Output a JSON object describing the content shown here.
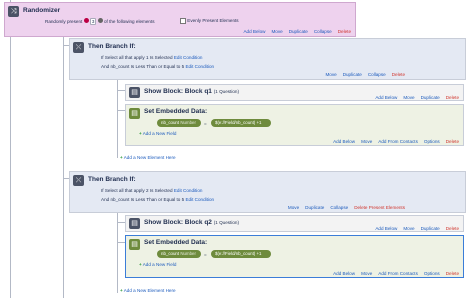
{
  "randomizer": {
    "title": "Randomizer",
    "present_pre": "Randomly present",
    "count": "3",
    "present_post": "of the following elements",
    "evenly_label": "Evenly Present Elements",
    "actions": [
      "Add Below",
      "Move",
      "Duplicate",
      "Collapse",
      "Delete"
    ]
  },
  "branch1": {
    "title": "Then Branch If:",
    "cond1_pre": "If",
    "cond1_text": "Select all that apply",
    "cond1_num": "1",
    "cond1_post": "Is Selected",
    "cond1_edit": "Edit Condition",
    "cond2_pre": "And",
    "cond2_text": "nb_count Is Less Than or Equal to",
    "cond2_num": "5",
    "cond2_edit": "Edit Condition",
    "actions": [
      "Move",
      "Duplicate",
      "Collapse",
      "Delete"
    ],
    "show_block": {
      "title": "Show Block: Block q1",
      "sub": "(1 Question)",
      "actions": [
        "Add Below",
        "Move",
        "Duplicate",
        "Delete"
      ]
    },
    "embedded": {
      "title": "Set Embedded Data:",
      "field": "nb_count",
      "type": "Number",
      "value": "$(e://Field/nb_count) +1",
      "add_field": "Add a New Field",
      "actions": [
        "Add Below",
        "Move",
        "Add From Contacts",
        "Options",
        "Delete"
      ]
    },
    "add_element": "Add a New Element Here"
  },
  "branch2": {
    "title": "Then Branch If:",
    "cond1_pre": "If",
    "cond1_text": "Select all that apply",
    "cond1_num": "2",
    "cond1_post": "Is Selected",
    "cond1_edit": "Edit Condition",
    "cond2_pre": "And",
    "cond2_text": "nb_count Is Less Than or Equal to",
    "cond2_num": "5",
    "cond2_edit": "Edit Condition",
    "actions": [
      "Move",
      "Duplicate",
      "Collapse",
      "Delete Present Elements"
    ],
    "show_block": {
      "title": "Show Block: Block q2",
      "sub": "(1 Question)",
      "actions": [
        "Add Below",
        "Move",
        "Duplicate",
        "Delete"
      ]
    },
    "embedded": {
      "title": "Set Embedded Data:",
      "field": "nb_count",
      "type": "Number",
      "value": "$(e://Field/nb_count) +1",
      "add_field": "Add a New Field",
      "actions": [
        "Add Below",
        "Move",
        "Add From Contacts",
        "Options",
        "Delete"
      ]
    },
    "add_element": "Add a New Element Here"
  },
  "colors": {
    "randomizer_bg": "#eed2ee",
    "branch_bg": "#e4e9f3",
    "block_bg": "#f3f3f3",
    "embedded_bg": "#eef2e4",
    "link": "#1c5bbd",
    "delete": "#d0342c",
    "pill": "#6e8b3d"
  }
}
